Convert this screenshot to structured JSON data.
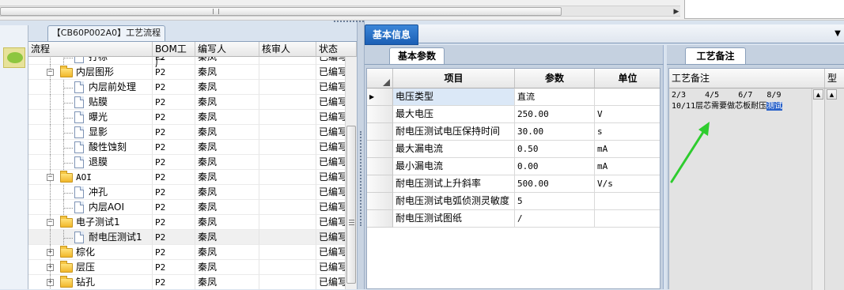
{
  "top": {
    "scroll_right_glyph": "▶"
  },
  "left_panel": {
    "tab_title": "【CB60P002A0】工艺流程",
    "columns": [
      "流程",
      "BOM工厂",
      "编写人",
      "核审人",
      "状态"
    ],
    "rows": [
      {
        "label": "打标",
        "type": "doc",
        "level": 2,
        "factory": "P2",
        "writer": "秦凤",
        "reviewer": "",
        "status": "已编写"
      },
      {
        "label": "内层图形",
        "type": "folder",
        "level": 1,
        "expanded": true,
        "factory": "P2",
        "writer": "秦凤",
        "reviewer": "",
        "status": "已编写"
      },
      {
        "label": "内层前处理",
        "type": "doc",
        "level": 2,
        "factory": "P2",
        "writer": "秦凤",
        "reviewer": "",
        "status": "已编写"
      },
      {
        "label": "贴膜",
        "type": "doc",
        "level": 2,
        "factory": "P2",
        "writer": "秦凤",
        "reviewer": "",
        "status": "已编写"
      },
      {
        "label": "曝光",
        "type": "doc",
        "level": 2,
        "factory": "P2",
        "writer": "秦凤",
        "reviewer": "",
        "status": "已编写"
      },
      {
        "label": "显影",
        "type": "doc",
        "level": 2,
        "factory": "P2",
        "writer": "秦凤",
        "reviewer": "",
        "status": "已编写"
      },
      {
        "label": "酸性蚀刻",
        "type": "doc",
        "level": 2,
        "factory": "P2",
        "writer": "秦凤",
        "reviewer": "",
        "status": "已编写"
      },
      {
        "label": "退膜",
        "type": "doc",
        "level": 2,
        "factory": "P2",
        "writer": "秦凤",
        "reviewer": "",
        "status": "已编写"
      },
      {
        "label": "AOI",
        "type": "folder",
        "level": 1,
        "expanded": true,
        "factory": "P2",
        "writer": "秦凤",
        "reviewer": "",
        "status": "已编写"
      },
      {
        "label": "冲孔",
        "type": "doc",
        "level": 2,
        "factory": "P2",
        "writer": "秦凤",
        "reviewer": "",
        "status": "已编写"
      },
      {
        "label": "内层AOI",
        "type": "doc",
        "level": 2,
        "factory": "P2",
        "writer": "秦凤",
        "reviewer": "",
        "status": "已编写"
      },
      {
        "label": "电子测试1",
        "type": "folder",
        "level": 1,
        "expanded": true,
        "factory": "P2",
        "writer": "秦凤",
        "reviewer": "",
        "status": "已编写"
      },
      {
        "label": "耐电压测试1",
        "type": "doc",
        "level": 2,
        "selected": true,
        "factory": "P2",
        "writer": "秦凤",
        "reviewer": "",
        "status": "已编写"
      },
      {
        "label": "棕化",
        "type": "folder",
        "level": 1,
        "expanded": false,
        "factory": "P2",
        "writer": "秦凤",
        "reviewer": "",
        "status": "已编写"
      },
      {
        "label": "层压",
        "type": "folder",
        "level": 1,
        "expanded": false,
        "factory": "P2",
        "writer": "秦凤",
        "reviewer": "",
        "status": "已编写"
      },
      {
        "label": "钻孔",
        "type": "folder",
        "level": 1,
        "expanded": false,
        "factory": "P2",
        "writer": "秦凤",
        "reviewer": "",
        "status": "已编写"
      }
    ]
  },
  "main": {
    "tab_label": "基本信息",
    "dropdown_glyph": "▼",
    "params_tab": "基本参数",
    "params_columns": [
      "项目",
      "参数",
      "单位"
    ],
    "params_rows": [
      {
        "item": "电压类型",
        "value": "直流",
        "unit": "",
        "current": true
      },
      {
        "item": "最大电压",
        "value": "250.00",
        "unit": "V"
      },
      {
        "item": "耐电压测试电压保持时间",
        "value": "30.00",
        "unit": "s"
      },
      {
        "item": "最大漏电流",
        "value": "0.50",
        "unit": "mA"
      },
      {
        "item": "最小漏电流",
        "value": "0.00",
        "unit": "mA"
      },
      {
        "item": "耐电压测试上升斜率",
        "value": "500.00",
        "unit": "V/s"
      },
      {
        "item": "耐电压测试电弧侦测灵敏度",
        "value": "5",
        "unit": ""
      },
      {
        "item": "耐电压测试图纸",
        "value": "/",
        "unit": ""
      }
    ],
    "row_indicator": "▶",
    "notes_tab": "工艺备注",
    "notes_header": "工艺备注",
    "notes_header_2": "型",
    "notes_line_1": "2/3    4/5    6/7   8/9",
    "notes_line_2_prefix": "10/11层芯需要做芯板耐压",
    "notes_line_2_highlight": "测试",
    "scroll_up_glyph": "▲",
    "arrow_color": "#2ecc2e"
  },
  "colors": {
    "accent": "#1b5fb5",
    "selection": "#2a62c9"
  }
}
